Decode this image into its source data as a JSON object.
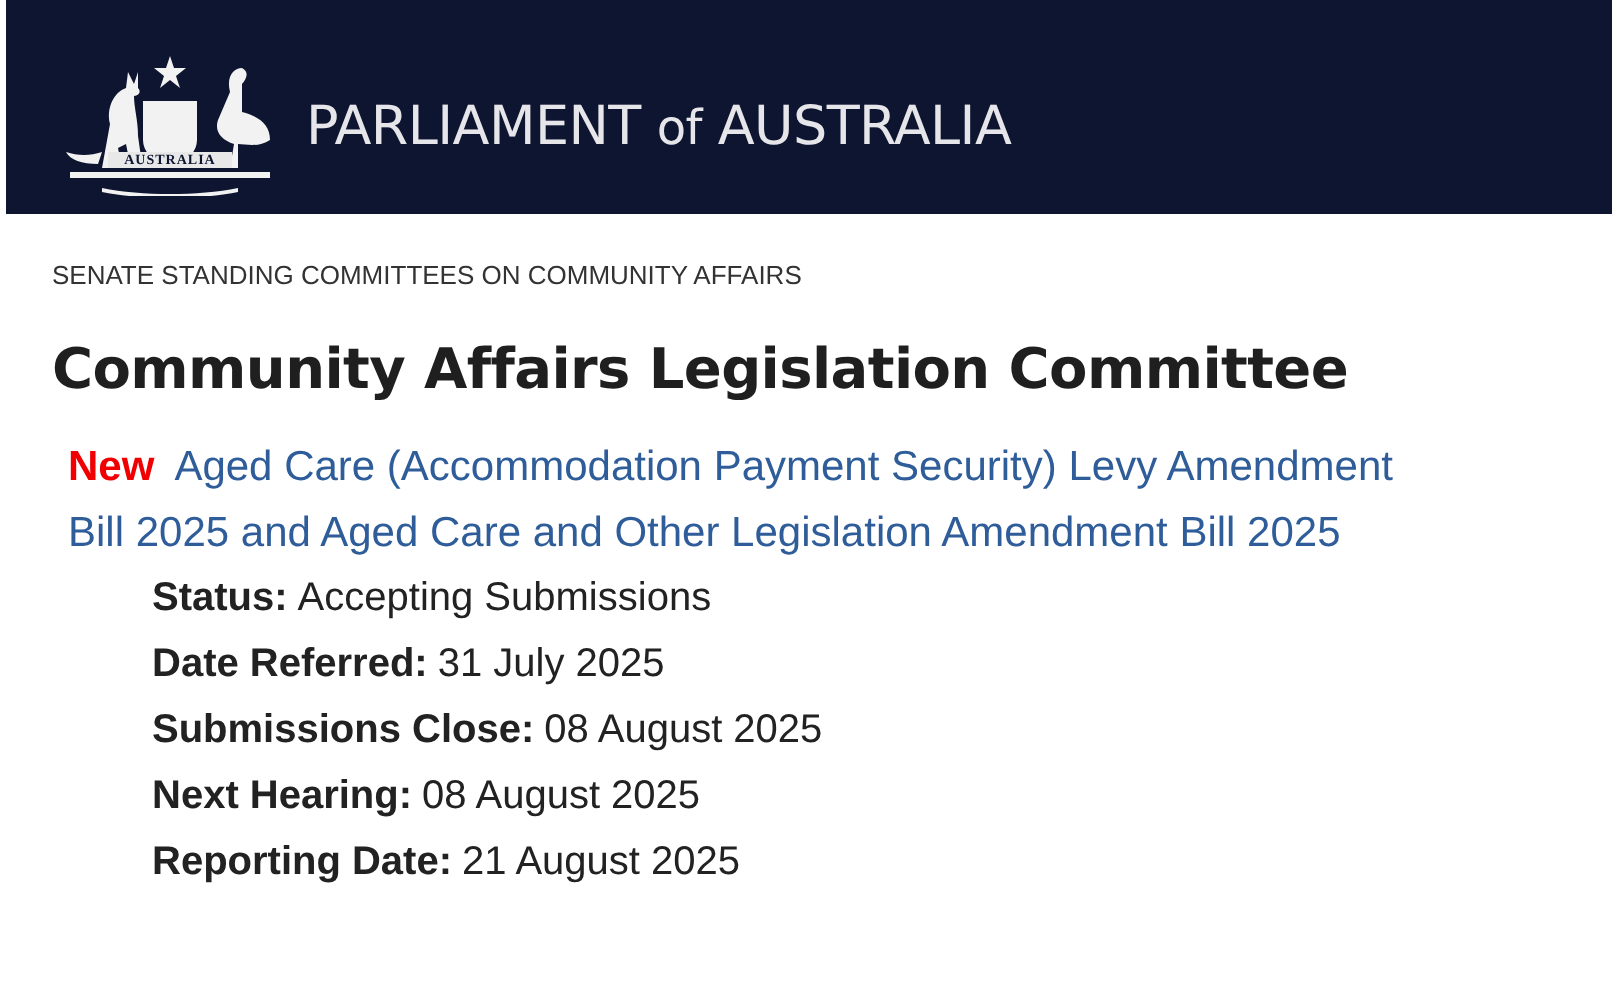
{
  "header": {
    "logo_caption": "AUSTRALIA",
    "title_parts": [
      "PARLIAMENT",
      "of",
      "AUSTRALIA"
    ]
  },
  "breadcrumb": "SENATE STANDING COMMITTEES ON COMMUNITY AFFAIRS",
  "heading": "Community Affairs Legislation Committee",
  "inquiry": {
    "badge": "New",
    "title": "Aged Care (Accommodation Payment Security) Levy Amendment Bill 2025 and Aged Care and Other Legislation Amendment Bill 2025",
    "details": [
      {
        "label": "Status:",
        "value": "Accepting Submissions"
      },
      {
        "label": "Date Referred:",
        "value": "31 July 2025"
      },
      {
        "label": "Submissions Close:",
        "value": "08 August 2025"
      },
      {
        "label": "Next Hearing:",
        "value": "08 August 2025"
      },
      {
        "label": "Reporting Date:",
        "value": "21 August 2025"
      }
    ]
  }
}
